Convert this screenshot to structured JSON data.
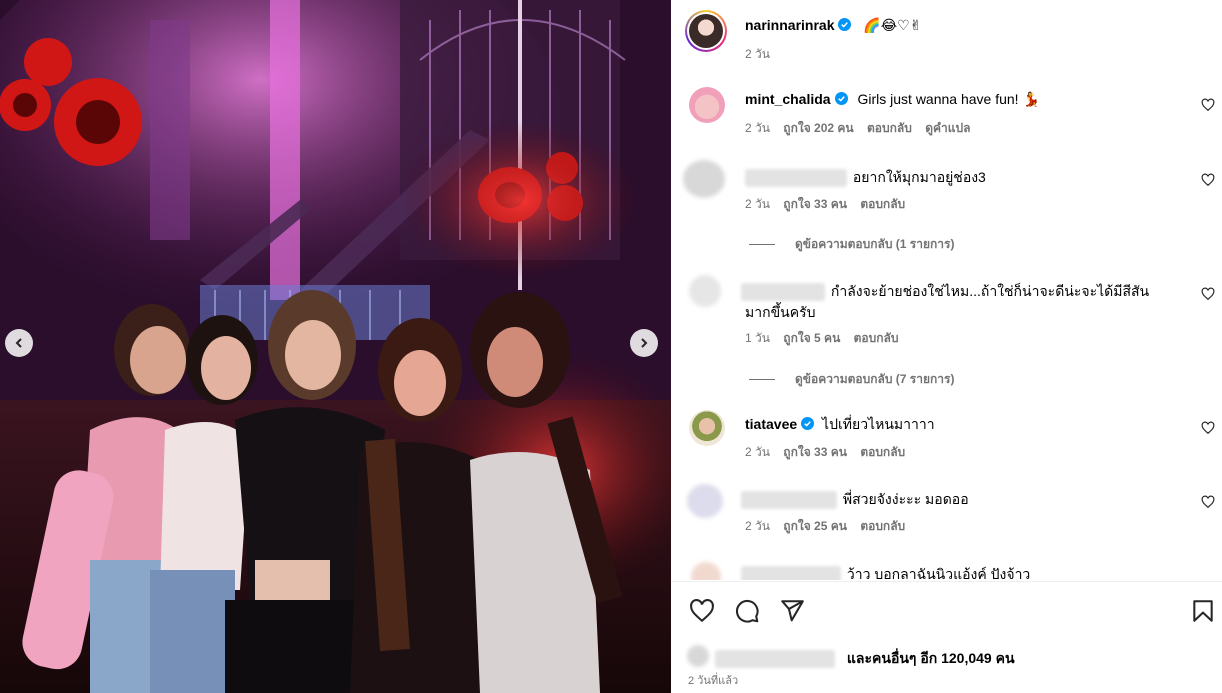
{
  "post": {
    "author": "narinnarinrak",
    "caption": "🌈😂♡✌",
    "age": "2 วัน"
  },
  "comments": [
    {
      "user": "mint_chalida",
      "verified": true,
      "text": "Girls just wanna have fun! 💃",
      "age": "2 วัน",
      "likes": "ถูกใจ 202 คน",
      "reply": "ตอบกลับ",
      "translate": "ดูคำแปล"
    },
    {
      "user": "",
      "text": "อยากให้มุกมาอยู่ช่อง3",
      "age": "2 วัน",
      "likes": "ถูกใจ 33 คน",
      "reply": "ตอบกลับ",
      "view_replies": "ดูข้อความตอบกลับ (1 รายการ)"
    },
    {
      "user": "",
      "text_line1": "กำลังจะย้ายช่องใช่ไหม...ถ้าใช่ก็น่าจะดีน่ะจะได้มีสีสัน",
      "text_line2": "มากขึ้นครับ",
      "age": "1 วัน",
      "likes": "ถูกใจ 5 คน",
      "reply": "ตอบกลับ",
      "view_replies": "ดูข้อความตอบกลับ (7 รายการ)"
    },
    {
      "user": "tiatavee",
      "verified": true,
      "text": "ไปเที่ยวไหนมาาาา",
      "age": "2 วัน",
      "likes": "ถูกใจ 33 คน",
      "reply": "ตอบกลับ"
    },
    {
      "user": "",
      "text": "พี่สวยจังง่ะะะ มอดออ",
      "age": "2 วัน",
      "likes": "ถูกใจ 25 คน",
      "reply": "ตอบกลับ"
    },
    {
      "user": "",
      "text": "ว้าว บอกลาฉันนิวแอ้งค์ ปังจ้าว"
    }
  ],
  "footer": {
    "likes_text": "และคนอื่นๆ อีก 120,049 คน",
    "timestamp": "2 วันที่แล้ว"
  },
  "icons": {
    "heart": "heart-icon",
    "comment": "comment-icon",
    "share": "share-icon",
    "save": "bookmark-icon",
    "prev": "chevron-left-icon",
    "next": "chevron-right-icon"
  },
  "colors": {
    "verified": "#0095f6",
    "meta_gray": "#737373",
    "photo_accent_pink": "#d44fd0",
    "photo_accent_red": "#e0262a"
  }
}
